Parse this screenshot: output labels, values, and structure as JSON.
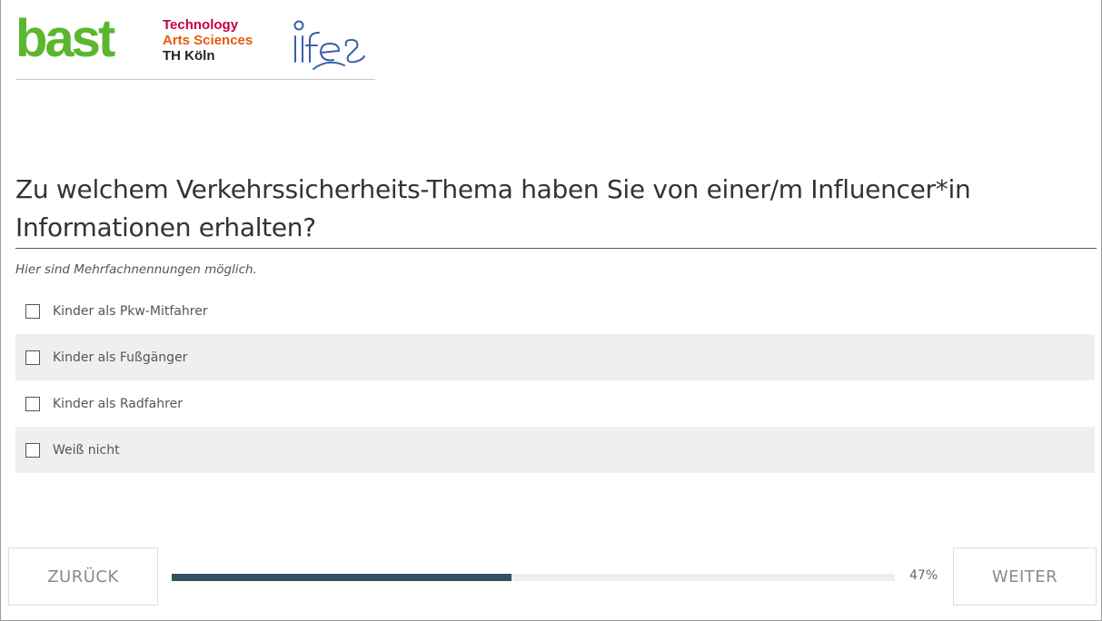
{
  "header": {
    "logos": {
      "bast": "bast",
      "th_line1": "Technology",
      "th_line2": "Arts Sciences",
      "th_line3": "TH Köln",
      "ifes": "ifes"
    },
    "colors": {
      "bast_green": "#5ab72e",
      "th_red": "#c6003b",
      "th_orange": "#e8590c",
      "ifes_blue": "#3a5fa8"
    }
  },
  "question": {
    "title": "Zu welchem Verkehrssicherheits-Thema haben Sie von einer/m Influencer*in Informationen erhalten?",
    "hint": "Hier sind Mehrfachnennungen möglich.",
    "options": [
      {
        "label": "Kinder als Pkw-Mitfahrer",
        "checked": false
      },
      {
        "label": "Kinder als Fußgänger",
        "checked": false
      },
      {
        "label": "Kinder als Radfahrer",
        "checked": false
      },
      {
        "label": "Weiß nicht",
        "checked": false
      }
    ]
  },
  "navigation": {
    "back_label": "ZURÜCK",
    "next_label": "WEITER",
    "progress_percent": 47,
    "progress_label": "47%",
    "progress_color": "#33505f"
  }
}
